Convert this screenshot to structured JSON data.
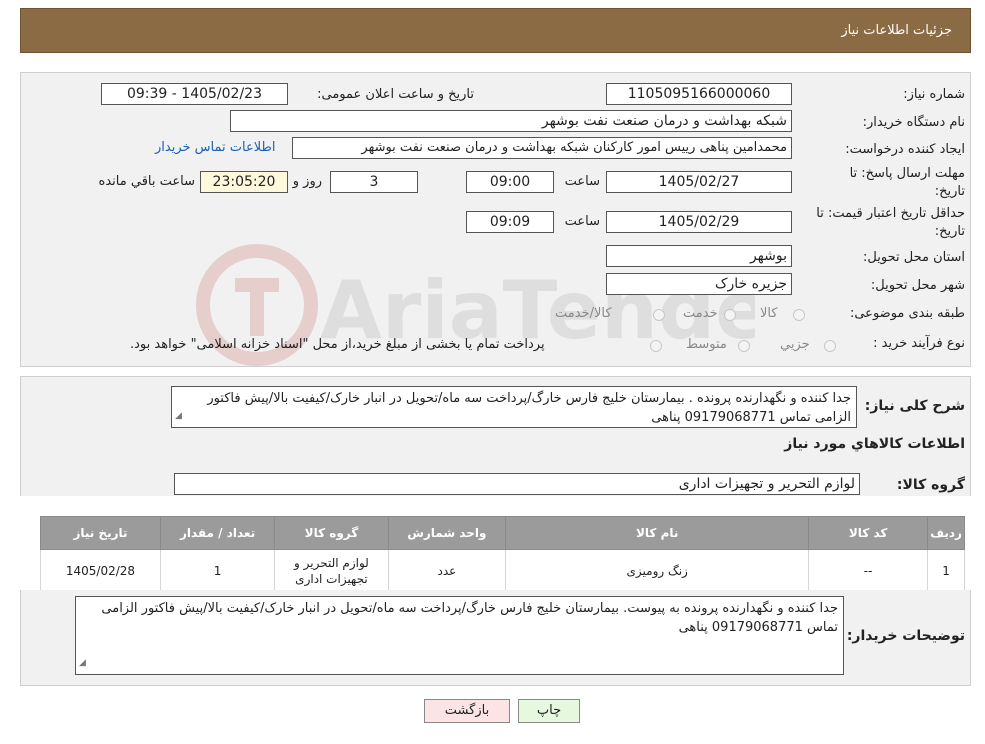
{
  "header": {
    "title": "جزئیات اطلاعات نیاز"
  },
  "fields": {
    "need_number_label": "شماره نیاز:",
    "need_number": "1105095166000060",
    "announce_label": "تاریخ و ساعت اعلان عمومی:",
    "announce_value": "1405/02/23 - 09:39",
    "buyer_label": "نام دستگاه خریدار:",
    "buyer_value": "شبکه بهداشت و درمان صنعت نفت بوشهر",
    "requester_label": "ایجاد کننده درخواست:",
    "requester_value": "محمدامین پناهی رییس امور کارکنان شبکه بهداشت و درمان صنعت نفت بوشهر",
    "contact_link": "اطلاعات تماس خریدار",
    "deadline_label_1": "مهلت ارسال پاسخ: تا",
    "deadline_label_2": "تاریخ:",
    "deadline_date": "1405/02/27",
    "time_label": "ساعت",
    "deadline_time": "09:00",
    "days_value": "3",
    "days_label": "روز و",
    "remaining_value": "23:05:20",
    "remaining_label": "ساعت باقي مانده",
    "validity_label_1": "حداقل تاریخ اعتبار قیمت: تا",
    "validity_label_2": "تاریخ:",
    "validity_date": "1405/02/29",
    "validity_time": "09:09",
    "province_label": "استان محل تحویل:",
    "province_value": "بوشهر",
    "city_label": "شهر محل تحویل:",
    "city_value": "جزیره خارک",
    "category_label": "طبقه بندی موضوعی:",
    "category_options": [
      "کالا",
      "خدمت",
      "کالا/خدمت"
    ],
    "process_label": "نوع فرآیند خرید :",
    "process_options": [
      "جزیي",
      "متوسط"
    ],
    "process_note": "پرداخت تمام یا بخشی از مبلغ خرید،از محل \"اسناد خزانه اسلامی\" خواهد بود."
  },
  "description": {
    "label": "شرح کلی نیاز:",
    "text": "جدا کننده و نگهدارنده پرونده . بیمارستان خلیج فارس خارگ/پرداخت سه ماه/تحویل در انبار خارک/کیفیت بالا/پیش فاکتور الزامی تماس 09179068771 پناهی"
  },
  "goods": {
    "section_title": "اطلاعات کالاهاي مورد نياز",
    "group_label": "گروه کالا:",
    "group_value": "لوازم التحریر و تجهیزات اداری",
    "columns": [
      "ردیف",
      "کد کالا",
      "نام کالا",
      "واحد شمارش",
      "گروه کالا",
      "تعداد / مقدار",
      "تاریخ نیاز"
    ],
    "rows": [
      {
        "index": "1",
        "code": "--",
        "name": "زنگ رومیزی",
        "unit": "عدد",
        "group": "لوازم التحریر و تجهیزات اداری",
        "qty": "1",
        "date": "1405/02/28"
      }
    ]
  },
  "buyer_notes": {
    "label": "توضیحات خریدار:",
    "text": "جدا کننده و نگهدارنده پرونده به پیوست. بیمارستان خلیج فارس خارگ/پرداخت سه ماه/تحویل در انبار خارک/کیفیت بالا/پیش فاکتور الزامی تماس 09179068771 پناهی"
  },
  "buttons": {
    "print": "چاپ",
    "back": "بازگشت"
  },
  "watermark": {
    "text": "AriaTender.neT"
  },
  "colors": {
    "header": "#8b6b43",
    "link": "#1a5fb4",
    "table_header": "#9b9b9b",
    "back_button": "#fde4e4",
    "print_button": "#e6f8de"
  }
}
